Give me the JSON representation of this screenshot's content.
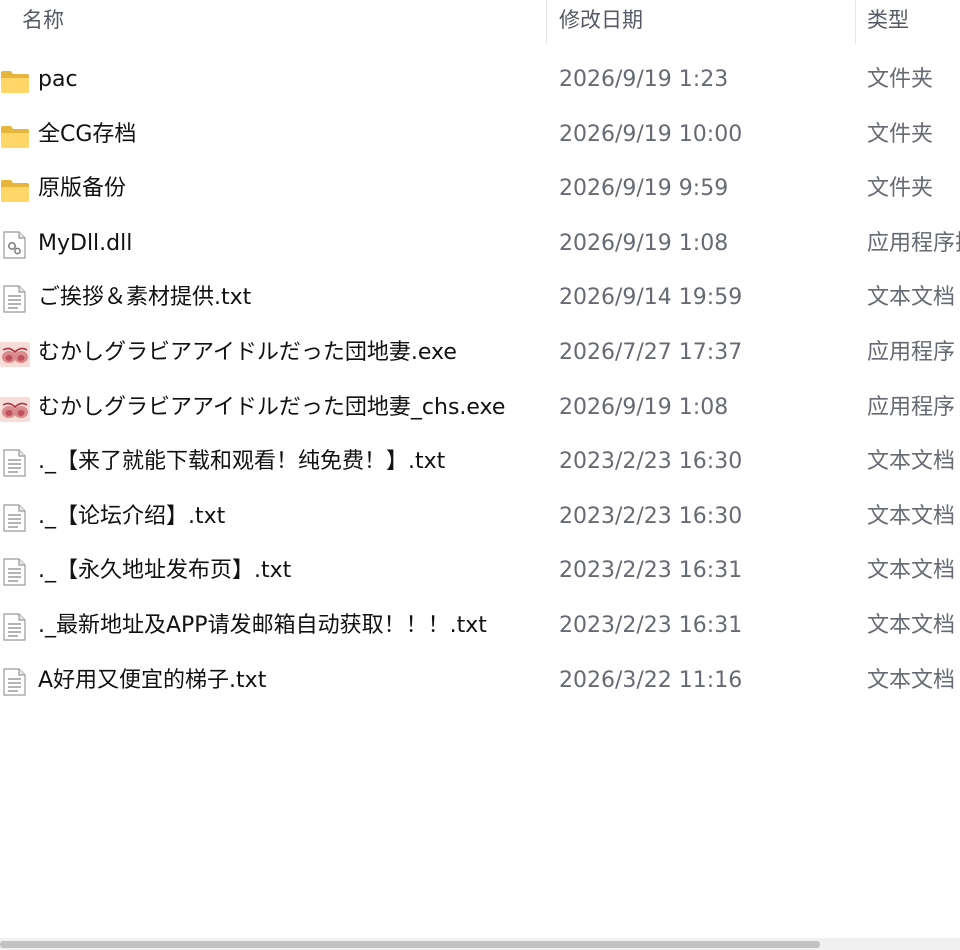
{
  "header": {
    "name": "名称",
    "date": "修改日期",
    "type": "类型"
  },
  "files": [
    {
      "name": "pac",
      "date": "2026/9/19 1:23",
      "type": "文件夹",
      "icon": "folder-icon"
    },
    {
      "name": "全CG存档",
      "date": "2026/9/19 10:00",
      "type": "文件夹",
      "icon": "folder-icon"
    },
    {
      "name": "原版备份",
      "date": "2026/9/19 9:59",
      "type": "文件夹",
      "icon": "folder-icon"
    },
    {
      "name": "MyDll.dll",
      "date": "2026/9/19 1:08",
      "type": "应用程序扩",
      "icon": "dll-file-icon"
    },
    {
      "name": "ご挨拶＆素材提供.txt",
      "date": "2026/9/14 19:59",
      "type": "文本文档",
      "icon": "text-file-icon"
    },
    {
      "name": "むかしグラビアアイドルだった団地妻.exe",
      "date": "2026/7/27 17:37",
      "type": "应用程序",
      "icon": "app-icon"
    },
    {
      "name": "むかしグラビアアイドルだった団地妻_chs.exe",
      "date": "2026/9/19 1:08",
      "type": "应用程序",
      "icon": "app-icon"
    },
    {
      "name": "._【来了就能下载和观看！纯免费！】.txt",
      "date": "2023/2/23 16:30",
      "type": "文本文档",
      "icon": "text-file-icon"
    },
    {
      "name": "._【论坛介绍】.txt",
      "date": "2023/2/23 16:30",
      "type": "文本文档",
      "icon": "text-file-icon"
    },
    {
      "name": "._【永久地址发布页】.txt",
      "date": "2023/2/23 16:31",
      "type": "文本文档",
      "icon": "text-file-icon"
    },
    {
      "name": "._最新地址及APP请发邮箱自动获取！！！.txt",
      "date": "2023/2/23 16:31",
      "type": "文本文档",
      "icon": "text-file-icon"
    },
    {
      "name": "A好用又便宜的梯子.txt",
      "date": "2026/3/22 11:16",
      "type": "文本文档",
      "icon": "text-file-icon"
    }
  ]
}
